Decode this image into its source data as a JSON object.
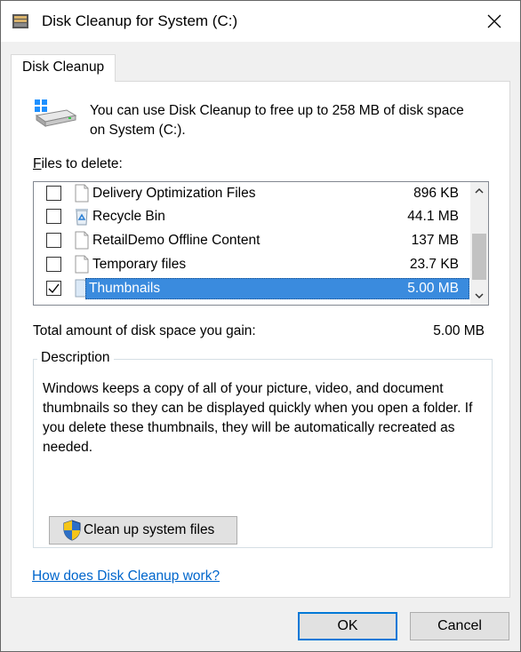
{
  "window": {
    "title": "Disk Cleanup for System (C:)",
    "app_icon": "disk-cleanup-icon",
    "close_icon": "close-icon"
  },
  "tabs": [
    {
      "label": "Disk Cleanup",
      "active": true
    }
  ],
  "intro": {
    "icon": "drive-icon",
    "text": "You can use Disk Cleanup to free up to 258 MB of disk space on System (C:)."
  },
  "files": {
    "label_prefix": "",
    "label_accel": "F",
    "label_rest": "iles to delete:",
    "items": [
      {
        "name": "Delivery Optimization Files",
        "size": "896 KB",
        "checked": false,
        "icon": "file-icon",
        "selected": false
      },
      {
        "name": "Recycle Bin",
        "size": "44.1 MB",
        "checked": false,
        "icon": "recycle-bin-icon",
        "selected": false
      },
      {
        "name": "RetailDemo Offline Content",
        "size": "137 MB",
        "checked": false,
        "icon": "file-icon",
        "selected": false
      },
      {
        "name": "Temporary files",
        "size": "23.7 KB",
        "checked": false,
        "icon": "file-icon",
        "selected": false
      },
      {
        "name": "Thumbnails",
        "size": "5.00 MB",
        "checked": true,
        "icon": "file-icon",
        "selected": true
      }
    ]
  },
  "total": {
    "label": "Total amount of disk space you gain:",
    "value": "5.00 MB"
  },
  "description": {
    "legend": "Description",
    "text": "Windows keeps a copy of all of your picture, video, and document thumbnails so they can be displayed quickly when you open a folder. If you delete these thumbnails, they will be automatically recreated as needed.",
    "cleanup_button": "Clean up system files"
  },
  "help_link": "How does Disk Cleanup work?",
  "buttons": {
    "ok": "OK",
    "cancel": "Cancel"
  },
  "colors": {
    "selection": "#3a8bde",
    "link": "#0066cc",
    "default_button_border": "#0078d7"
  }
}
